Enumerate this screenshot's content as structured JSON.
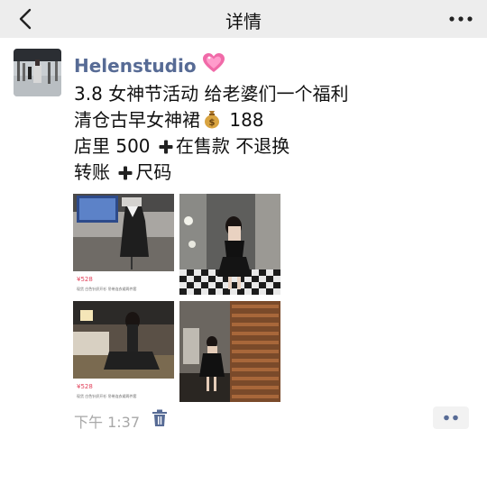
{
  "nav": {
    "title": "详情",
    "back_icon": "chevron-left-icon",
    "more_icon": "more-dots-icon"
  },
  "post": {
    "author": "Helenstudio",
    "author_emoji": "sparkling-heart-icon",
    "lines": [
      "3.8 女神节活动 给老婆们一个福利",
      "清仓古早女神裙",
      "188",
      "店里 500",
      "在售款 不退换",
      "转账",
      "尺码"
    ],
    "photos": [
      {
        "price": "¥528",
        "caption": "现货 白色针织开衫 吊带连衣裙两件套"
      },
      {
        "price": "",
        "caption": ""
      },
      {
        "price": "¥528",
        "caption": "现货 白色针织开衫 吊带连衣裙两件套"
      },
      {
        "price": "",
        "caption": ""
      }
    ],
    "time": "下午 1:37"
  },
  "colors": {
    "nav_bg": "#ededed",
    "author_name": "#576b95",
    "timestamp": "#a8a8a8",
    "price": "#e2415a"
  }
}
